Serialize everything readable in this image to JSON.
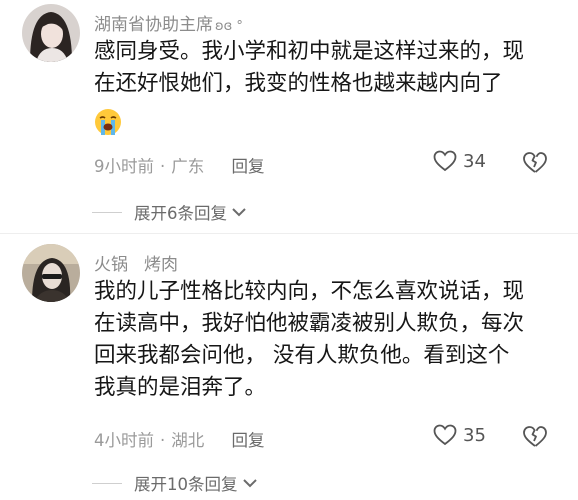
{
  "comments": [
    {
      "username": "湖南省协助主席",
      "username_suffix": "ʚɞ °",
      "tag": "",
      "lines": [
        "感同身受。我小学和初中就是这样过来的，现",
        "在还好恨她们，我变的性格也越来越内向了"
      ],
      "emoji": "loudly-crying-face",
      "time": "9小时前",
      "location": "广东",
      "reply_label": "回复",
      "likes": "34",
      "expand_label": "展开6条回复"
    },
    {
      "username": "火锅",
      "username_suffix": "",
      "tag": "烤肉",
      "lines": [
        "我的儿子性格比较内向，不怎么喜欢说话，现",
        "在读高中，我好怕他被霸凌被别人欺负，每次",
        "回来我都会问他， 没有人欺负他。看到这个",
        "我真的是泪奔了。"
      ],
      "emoji": "",
      "time": "4小时前",
      "location": "湖北",
      "reply_label": "回复",
      "likes": "35",
      "expand_label": "展开10条回复"
    }
  ],
  "separator": "·",
  "colors": {
    "text": "#161616",
    "meta": "#9a9a9a",
    "background": "#ffffff"
  }
}
